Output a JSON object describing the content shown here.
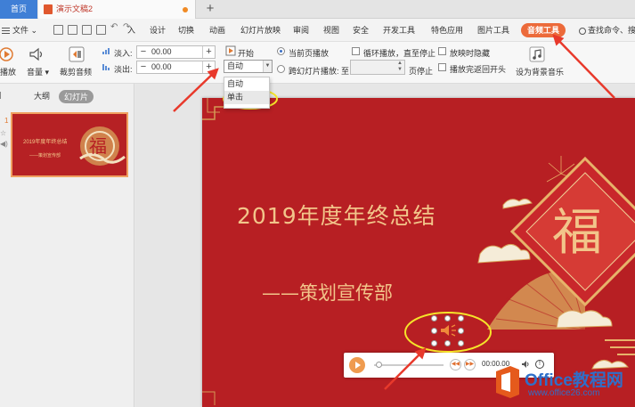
{
  "tabs": {
    "home_label": "首页",
    "doc_title": "演示文稿2",
    "new_tab": "+"
  },
  "menubar": {
    "file_label": "文件",
    "items": [
      "入",
      "设计",
      "切换",
      "动画",
      "幻灯片放映",
      "审阅",
      "视图",
      "安全",
      "开发工具",
      "特色应用",
      "图片工具"
    ],
    "active_label": "音频工具",
    "search_label": "查找命令、搜"
  },
  "ribbon": {
    "play_label": "播放",
    "volume_label": "音量",
    "trim_label": "裁剪音频",
    "fade_in_label": "淡入:",
    "fade_in_value": "00.00",
    "fade_out_label": "淡出:",
    "fade_out_value": "00.00",
    "start_label": "开始",
    "start_value": "自动",
    "current_page_label": "当前页播放",
    "cross_slide_label": "跨幻灯片播放: 至",
    "page_stop_label": "页停止",
    "loop_label": "循环播放，直至停止",
    "hide_label": "放映时隐藏",
    "rewind_label": "播放完返回开头",
    "bgm_label": "设为背景音乐",
    "start_options": [
      "自动",
      "单击"
    ]
  },
  "leftpane": {
    "outline_label": "大纲",
    "slides_label": "幻灯片",
    "slide_number": "1",
    "thumb_title": "2019年度年终总结",
    "thumb_sub": "——策划宣传部",
    "thumb_seal": "福"
  },
  "slide": {
    "title": "2019年度年终总结",
    "subtitle": "——策划宣传部",
    "seal_char": "福"
  },
  "player": {
    "time": "00:00.00"
  },
  "watermark": {
    "brand": "Office教程网",
    "url": "www.office26.com"
  },
  "colors": {
    "accent": "#ec6a3a",
    "slide_red": "#b71f23",
    "gold": "#f2c58a",
    "annotation": "#e8392b",
    "highlight_yellow": "#f5e42a"
  }
}
